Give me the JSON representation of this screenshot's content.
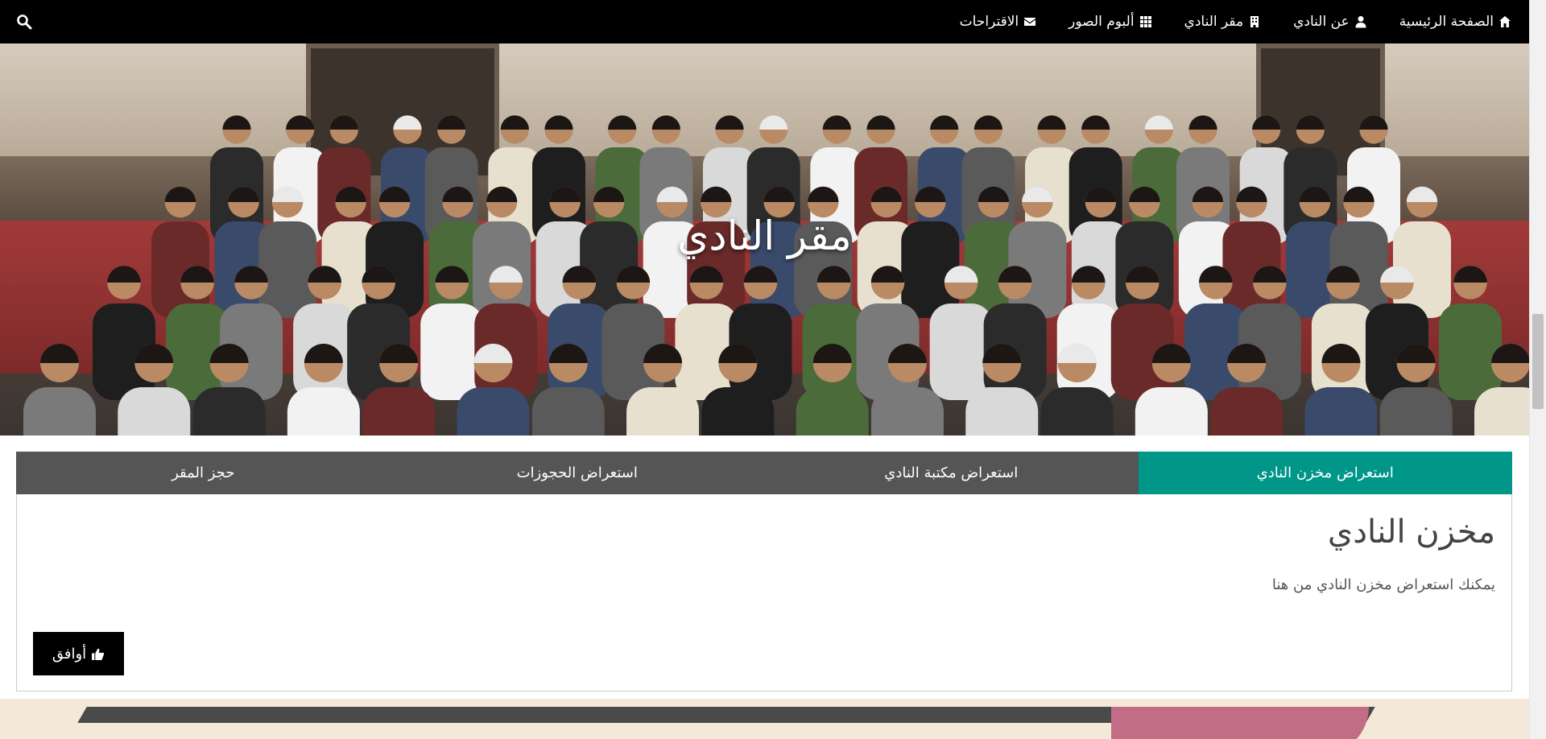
{
  "nav": {
    "items": [
      {
        "label": "الصفحة الرئيسية",
        "icon": "home-icon"
      },
      {
        "label": "عن النادي",
        "icon": "user-icon"
      },
      {
        "label": "مقر النادي",
        "icon": "building-icon"
      },
      {
        "label": "ألبوم الصور",
        "icon": "grid-icon"
      },
      {
        "label": "الاقتراحات",
        "icon": "envelope-icon"
      }
    ],
    "search_icon": "search-icon"
  },
  "hero": {
    "title": "مقر النادي"
  },
  "tabs": [
    {
      "label": "استعراض مخزن النادي",
      "active": true
    },
    {
      "label": "استعراض مكتبة النادي",
      "active": false
    },
    {
      "label": "استعراض الحجوزات",
      "active": false
    },
    {
      "label": "حجز المقر",
      "active": false
    }
  ],
  "panel": {
    "title": "مخزن النادي",
    "text": "يمكنك استعراض مخزن النادي من هنا",
    "button_label": "أوافق",
    "button_icon": "thumbs-up-icon"
  },
  "colors": {
    "navbar": "#000000",
    "tab_active": "#009688",
    "tab_inactive": "#555555",
    "button": "#000000"
  }
}
